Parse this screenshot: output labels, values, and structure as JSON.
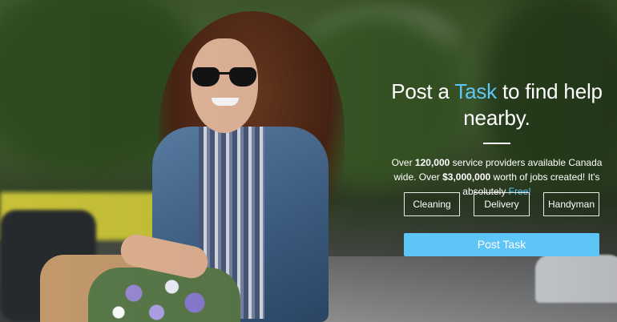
{
  "hero": {
    "headline_pre": "Post a ",
    "headline_accent": "Task",
    "headline_post": " to find help nearby.",
    "sub_pre": "Over ",
    "sub_count": "120,000",
    "sub_mid": " service providers available Canada wide. Over ",
    "sub_amount": "$3,000,000",
    "sub_post": " worth of jobs created! It's absolutely ",
    "sub_free": "Free!",
    "categories": [
      "Cleaning",
      "Delivery",
      "Handyman"
    ],
    "post_button_label": "Post Task"
  },
  "colors": {
    "accent": "#5ec6f6",
    "text": "#ffffff"
  }
}
